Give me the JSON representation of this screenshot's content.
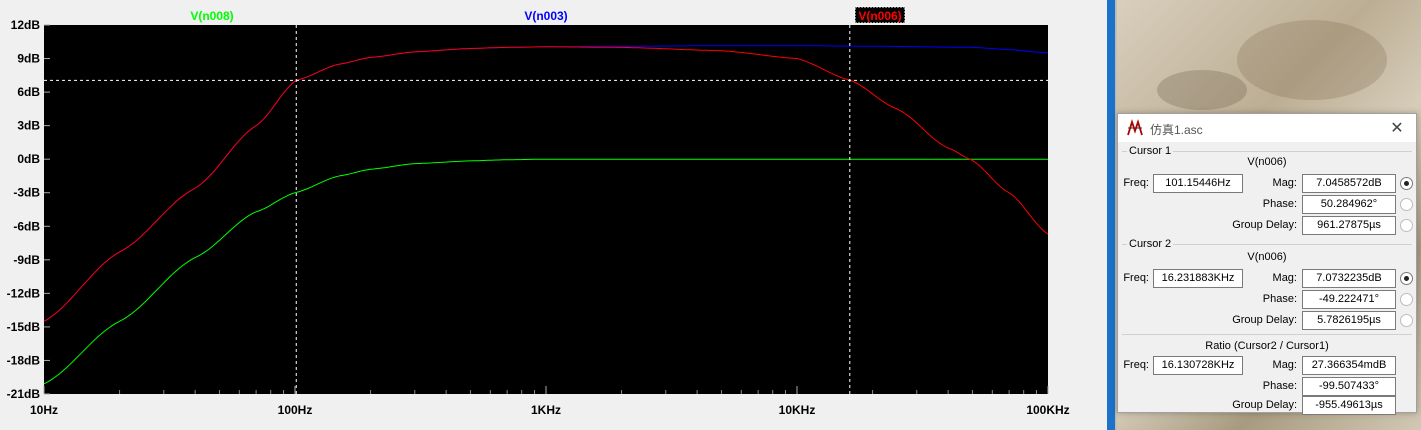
{
  "plot": {
    "traces": [
      {
        "name": "V(n008)",
        "color": "#00ff00"
      },
      {
        "name": "V(n003)",
        "color": "#0000ff"
      },
      {
        "name": "V(n006)",
        "color": "#ff0000"
      }
    ],
    "y_ticks": [
      "12dB",
      "9dB",
      "6dB",
      "3dB",
      "0dB",
      "-3dB",
      "-6dB",
      "-9dB",
      "-12dB",
      "-15dB",
      "-18dB",
      "-21dB"
    ],
    "x_ticks": [
      "10Hz",
      "100Hz",
      "1KHz",
      "10KHz",
      "100KHz"
    ],
    "background": "#000000"
  },
  "chart_data": {
    "type": "line",
    "xlabel": "",
    "ylabel": "",
    "x_scale": "log",
    "xlim": [
      10,
      100000
    ],
    "ylim": [
      -21,
      12
    ],
    "grid": false,
    "series": [
      {
        "name": "V(n008)",
        "color": "#00ff00",
        "x": [
          10,
          20,
          40,
          70,
          100,
          150,
          200,
          300,
          500,
          700,
          1000,
          10000,
          100000
        ],
        "y": [
          -20.1,
          -14.5,
          -8.8,
          -4.7,
          -3.0,
          -1.5,
          -0.9,
          -0.4,
          -0.15,
          -0.05,
          0,
          0,
          0
        ]
      },
      {
        "name": "V(n003)",
        "color": "#0000ff",
        "x": [
          10,
          20,
          40,
          70,
          101.15,
          150,
          200,
          300,
          500,
          700,
          1000,
          2000,
          5000,
          10000,
          20000,
          50000,
          70000,
          100000
        ],
        "y": [
          -14.5,
          -8.3,
          -2.6,
          3.0,
          7.05,
          8.5,
          9.1,
          9.6,
          9.9,
          10.0,
          10.05,
          10.1,
          10.15,
          10.15,
          10.1,
          10.0,
          9.8,
          9.5
        ]
      },
      {
        "name": "V(n006)",
        "color": "#ff0000",
        "x": [
          10,
          20,
          40,
          70,
          101.15,
          150,
          200,
          300,
          500,
          700,
          1000,
          2000,
          5000,
          10000,
          16231.883,
          25000,
          40000,
          49000,
          70000,
          100000
        ],
        "y": [
          -14.5,
          -8.3,
          -2.6,
          3.0,
          7.05,
          8.5,
          9.1,
          9.6,
          9.9,
          10.0,
          10.05,
          10.0,
          9.7,
          9.0,
          7.07,
          4.5,
          1.0,
          0.0,
          -3.0,
          -6.7
        ]
      }
    ],
    "cursors": [
      {
        "x": 101.15446,
        "y": 7.0458572
      },
      {
        "x": 16231.883,
        "y": 7.0732235
      }
    ]
  },
  "dialog": {
    "title": "仿真1.asc",
    "close": "✕",
    "cursor1": {
      "label": "Cursor 1",
      "node": "V(n006)",
      "freq_label": "Freq:",
      "freq": "101.15446Hz",
      "mag_label": "Mag:",
      "mag": "7.0458572dB",
      "phase_label": "Phase:",
      "phase": "50.284962°",
      "group_delay_label": "Group Delay:",
      "group_delay": "961.27875µs"
    },
    "cursor2": {
      "label": "Cursor 2",
      "node": "V(n006)",
      "freq_label": "Freq:",
      "freq": "16.231883KHz",
      "mag_label": "Mag:",
      "mag": "7.0732235dB",
      "phase_label": "Phase:",
      "phase": "-49.222471°",
      "group_delay_label": "Group Delay:",
      "group_delay": "5.7826195µs"
    },
    "ratio": {
      "label": "Ratio (Cursor2 / Cursor1)",
      "freq_label": "Freq:",
      "freq": "16.130728KHz",
      "mag_label": "Mag:",
      "mag": "27.366354mdB",
      "phase_label": "Phase:",
      "phase": "-99.507433°",
      "group_delay_label": "Group Delay:",
      "group_delay": "-955.49613µs"
    }
  }
}
